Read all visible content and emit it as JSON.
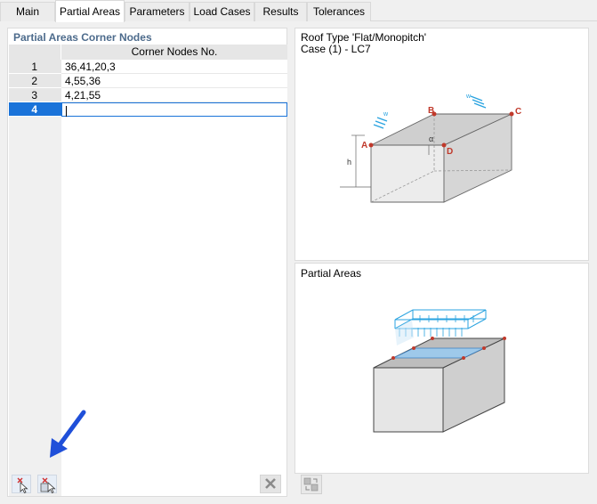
{
  "tabs": [
    {
      "label": "Main",
      "active": false
    },
    {
      "label": "Partial Areas",
      "active": true
    },
    {
      "label": "Parameters",
      "active": false
    },
    {
      "label": "Load Cases",
      "active": false
    },
    {
      "label": "Results",
      "active": false
    },
    {
      "label": "Tolerances",
      "active": false
    }
  ],
  "left_panel": {
    "title": "Partial Areas Corner Nodes",
    "column_header": "Corner Nodes No.",
    "rows": [
      {
        "no": "1",
        "value": "36,41,20,3"
      },
      {
        "no": "2",
        "value": "4,55,36"
      },
      {
        "no": "3",
        "value": "4,21,55"
      },
      {
        "no": "4",
        "value": ""
      }
    ],
    "selected_row": "4"
  },
  "toolbar": {
    "left_buttons": [
      "pick-nodes-icon",
      "pick-surface-icon"
    ],
    "delete_icon": "delete-x-icon"
  },
  "roof_figure": {
    "title_line1": "Roof Type 'Flat/Monopitch'",
    "title_line2": "Case (1) - LC7",
    "point_labels": [
      "A",
      "B",
      "C",
      "D"
    ],
    "dimension_label": "h",
    "angle_label": "α",
    "wind_label": "w"
  },
  "partial_figure": {
    "title": "Partial Areas"
  },
  "colors": {
    "accent_blue": "#1a73d9",
    "title_blue": "#4d6b8c",
    "node_red": "#c0392b",
    "load_blue": "#29a3e0",
    "annotation_arrow": "#1f4fd9"
  }
}
